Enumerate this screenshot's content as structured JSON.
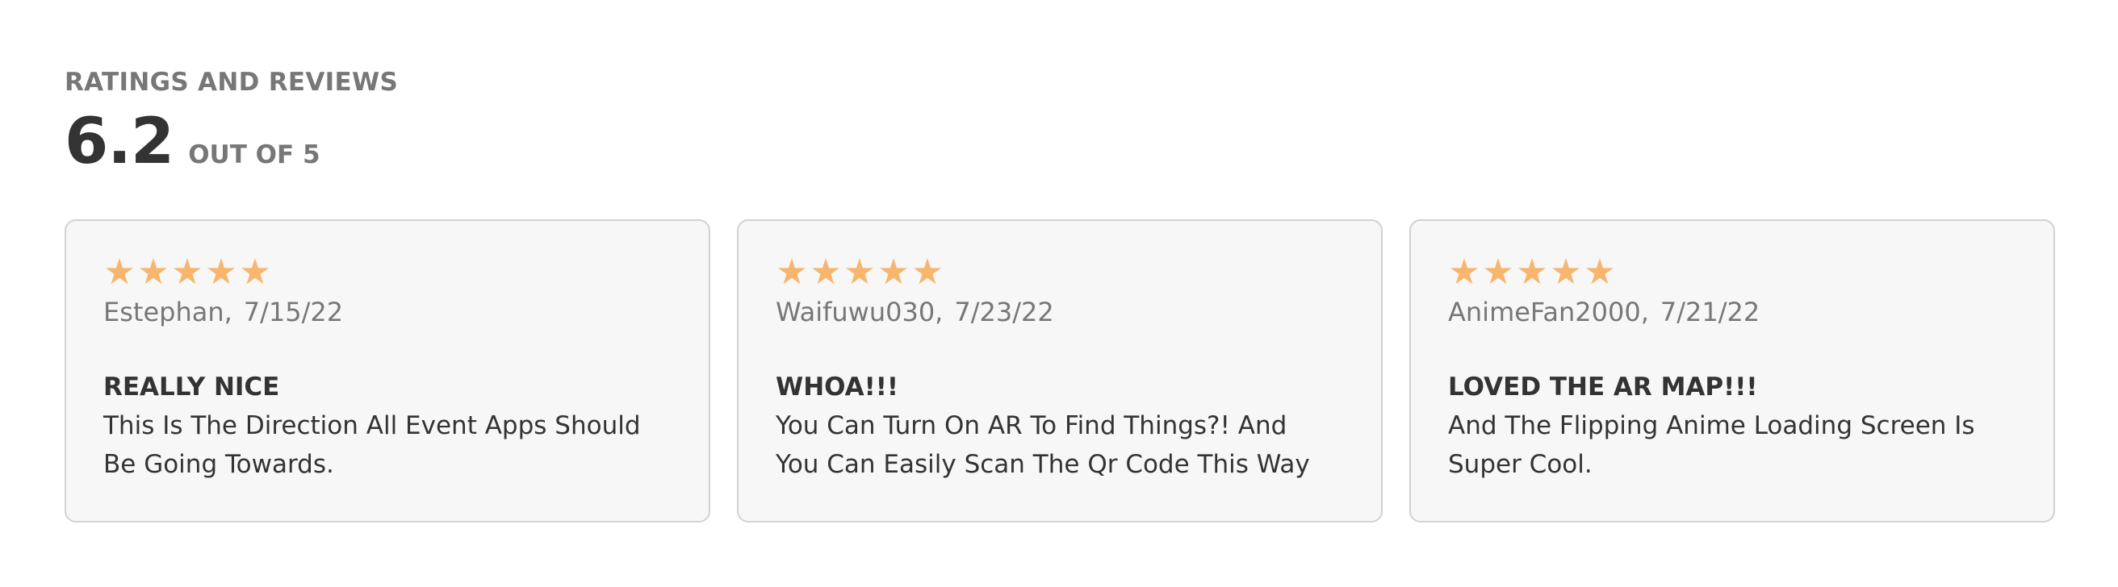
{
  "header": {
    "title": "RATINGS AND REVIEWS",
    "score": "6.2",
    "score_suffix": "OUT OF 5"
  },
  "colors": {
    "star": "#f8b56e",
    "card_background": "#f7f7f7",
    "card_border": "#d2d2d2",
    "muted_text": "#777777",
    "main_text": "#333333"
  },
  "reviews": [
    {
      "stars": 5,
      "star_glyphs": [
        "★",
        "★",
        "★",
        "★",
        "★"
      ],
      "author": "Estephan,",
      "date": "7/15/22",
      "title": "REALLY NICE",
      "body_lines": [
        "This Is The Direction All Event Apps Should",
        "Be Going Towards."
      ]
    },
    {
      "stars": 5,
      "star_glyphs": [
        "★",
        "★",
        "★",
        "★",
        "★"
      ],
      "author": "Waifuwu030,",
      "date": "7/23/22",
      "title": "WHOA!!!",
      "body_lines": [
        "You Can Turn On AR To Find Things?! And",
        "You Can Easily Scan The Qr Code This Way"
      ]
    },
    {
      "stars": 5,
      "star_glyphs": [
        "★",
        "★",
        "★",
        "★",
        "★"
      ],
      "author": "AnimeFan2000,",
      "date": "7/21/22",
      "title": "LOVED THE AR MAP!!!",
      "body_lines": [
        "And The Flipping Anime Loading Screen Is",
        "Super Cool."
      ]
    }
  ]
}
